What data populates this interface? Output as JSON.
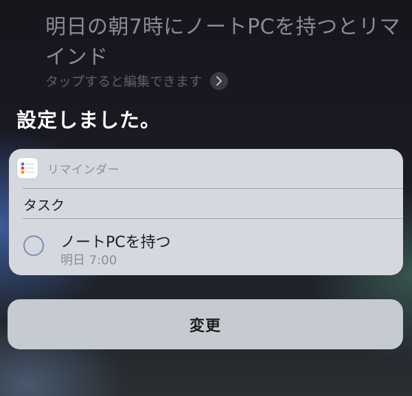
{
  "siri": {
    "query": "明日の朝7時にノートPCを持つとリマインド",
    "edit_hint": "タップすると編集できます",
    "response": "設定しました。"
  },
  "reminder_card": {
    "app_name": "リマインダー",
    "app_icon": "reminders-app-icon",
    "section_label": "タスク",
    "task": {
      "title": "ノートPCを持つ",
      "due": "明日 7:00",
      "completed": false
    }
  },
  "actions": {
    "change_label": "変更"
  },
  "colors": {
    "reminder_dot_blue": "#2f7cf6",
    "reminder_dot_red": "#ff3b30",
    "reminder_dot_orange": "#ff9500",
    "task_circle": "#7b8eb5"
  }
}
